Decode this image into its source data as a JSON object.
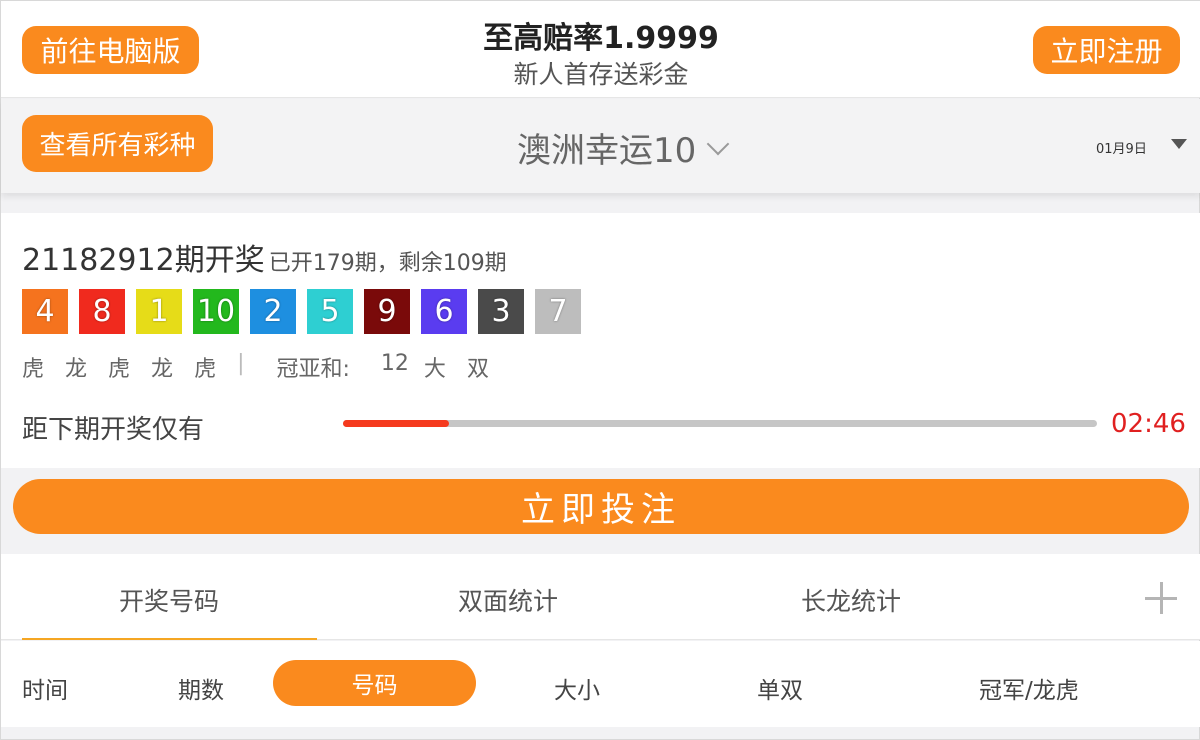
{
  "header": {
    "pc_button": "前往电脑版",
    "headline": "至高赔率1.9999",
    "subline": "新人首存送彩金",
    "register_button": "立即注册"
  },
  "game_bar": {
    "all_button": "查看所有彩种",
    "game_name": "澳洲幸运10",
    "date": "01月9日"
  },
  "draw": {
    "issue_label": "21182912期开奖",
    "progress_text": "已开179期，剩余109期",
    "numbers": [
      {
        "value": "4",
        "color": "#f5731e"
      },
      {
        "value": "8",
        "color": "#f02a1e"
      },
      {
        "value": "1",
        "color": "#e6dc18"
      },
      {
        "value": "10",
        "color": "#23b81d"
      },
      {
        "value": "2",
        "color": "#1e8fe0"
      },
      {
        "value": "5",
        "color": "#2ecfd2"
      },
      {
        "value": "9",
        "color": "#7a0a0a"
      },
      {
        "value": "6",
        "color": "#5a3cf0"
      },
      {
        "value": "3",
        "color": "#4a4a4a"
      },
      {
        "value": "7",
        "color": "#bdbdbd"
      }
    ],
    "dragon_tiger": [
      "虎",
      "龙",
      "虎",
      "龙",
      "虎"
    ],
    "separator": "|",
    "sum_label": "冠亚和:",
    "sum_value": "12",
    "size": "大",
    "parity": "双",
    "countdown_label": "距下期开奖仅有",
    "countdown_progress": 0.14,
    "countdown_time": "02:46"
  },
  "bet_button": "立即投注",
  "tabs": [
    "开奖号码",
    "双面统计",
    "长龙统计"
  ],
  "active_tab": 0,
  "filters": [
    "时间",
    "期数",
    "号码",
    "大小",
    "单双",
    "冠军/龙虎"
  ],
  "active_filter": 2,
  "colors": {
    "accent": "#fa8a1e",
    "timer": "#e02020",
    "progress_fill": "#f53a1e"
  }
}
